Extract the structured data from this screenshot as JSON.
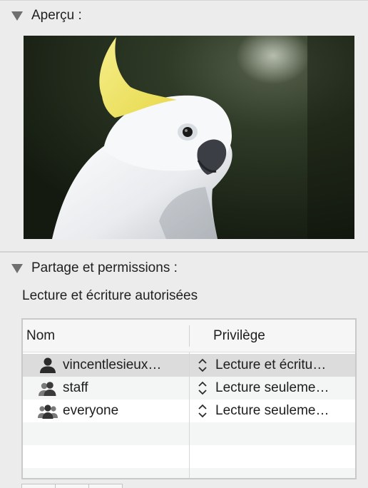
{
  "preview_section": {
    "title": "Aperçu :",
    "image_alt": "cockatoo-photo"
  },
  "sharing_section": {
    "title": "Partage et permissions :",
    "summary": "Lecture et écriture autorisées"
  },
  "permissions_table": {
    "columns": {
      "name": "Nom",
      "privilege": "Privilège"
    },
    "rows": [
      {
        "name": "vincentlesieux…",
        "privilege": "Lecture et écritu…",
        "icon": "single-user-icon",
        "selected": true
      },
      {
        "name": "staff",
        "privilege": "Lecture seuleme…",
        "icon": "group-icon",
        "selected": false
      },
      {
        "name": "everyone",
        "privilege": "Lecture seuleme…",
        "icon": "everyone-icon",
        "selected": false
      }
    ]
  },
  "colors": {
    "background": "#ececec",
    "selected_row": "#dcdcdc",
    "striped_row": "#f4f5f5"
  }
}
